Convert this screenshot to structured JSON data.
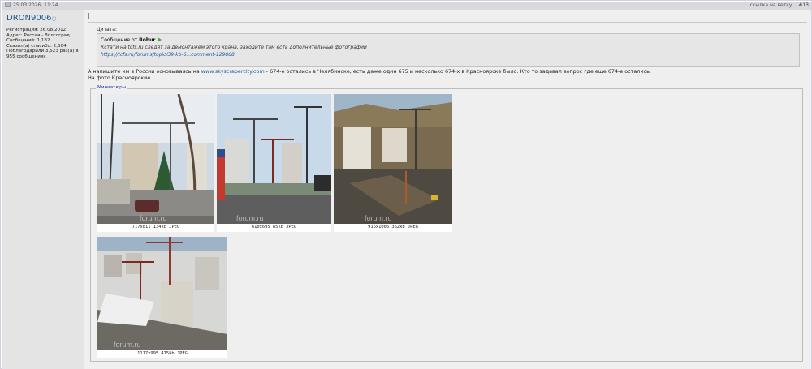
{
  "header": {
    "date": "25.03.2026, 11:24",
    "link_label": "ссылка на ветку",
    "post_number": "#13"
  },
  "user": {
    "name": "DRON9006",
    "info": [
      "Регистрация: 26.08.2012",
      "Адрес: Россия - Волгоград",
      "Сообщений: 1,182",
      "Сказал(а) спасибо: 2,504",
      "Поблагодарили 3,523 раз(а) в 955 сообщениях"
    ]
  },
  "quote": {
    "label": "Цитата:",
    "from_prefix": "Сообщение от",
    "author": "Robur",
    "text": "Кстати на tcfs.ru следят за демонтажем этого крана, заходите там есть дополнительные фотографии",
    "link": "https://tcfs.ru/forums/topic/39-kb-6...comment-129868"
  },
  "message": {
    "before_link": "А напишите им в России основываясь на",
    "link": "www.skyscrapercity.com",
    "after_link": "- 674-е остались в Челябинске, есть даже один 675 и несколько 674-х в Красноярске было. Кто то задавал вопрос где еще 674-е остались.",
    "line2": "На фото Красноярские."
  },
  "attachments": {
    "legend": "Миниатюры",
    "watermark": "forum.ru",
    "items": [
      {
        "caption": "717x811 134kb JPEG"
      },
      {
        "caption": "610x695 85kb JPEG"
      },
      {
        "caption": "916x1006 362kb JPEG"
      },
      {
        "caption": "1117x995 475kb JPEG"
      }
    ]
  }
}
